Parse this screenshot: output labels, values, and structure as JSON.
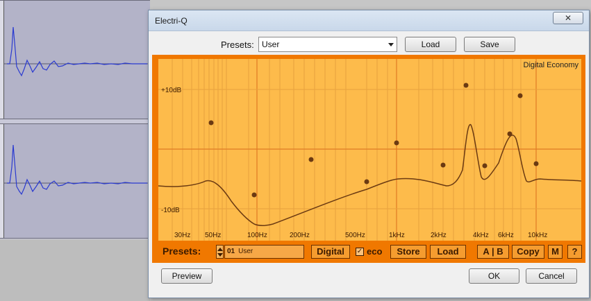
{
  "dialog": {
    "title": "Electri-Q",
    "close_label": "✕",
    "presets_label": "Presets:",
    "presets_value": "User",
    "load_label": "Load",
    "save_label": "Save",
    "preview_label": "Preview",
    "ok_label": "OK",
    "cancel_label": "Cancel"
  },
  "plugin": {
    "mode_label": "Digital Economy",
    "db_labels": [
      "+10dB",
      "-10dB"
    ],
    "freq_labels": [
      "30Hz",
      "50Hz",
      "100Hz",
      "200Hz",
      "500Hz",
      "1kHz",
      "2kHz",
      "4kHz",
      "6kHz",
      "10kHz"
    ],
    "bottom": {
      "presets_label": "Presets:",
      "preset_number": "01",
      "preset_name": "User",
      "digital_label": "Digital",
      "eco_checked": true,
      "eco_label": "eco",
      "store_label": "Store",
      "load_label": "Load",
      "ab_label": "A | B",
      "copy_label": "Copy",
      "m_label": "M",
      "help_label": "?"
    }
  },
  "colors": {
    "panel": "#f07800",
    "graph_bg": "#fdbb4b",
    "curve": "#6b3a12",
    "grid": "#e89a3a",
    "waveform": "#2a3ad0"
  }
}
